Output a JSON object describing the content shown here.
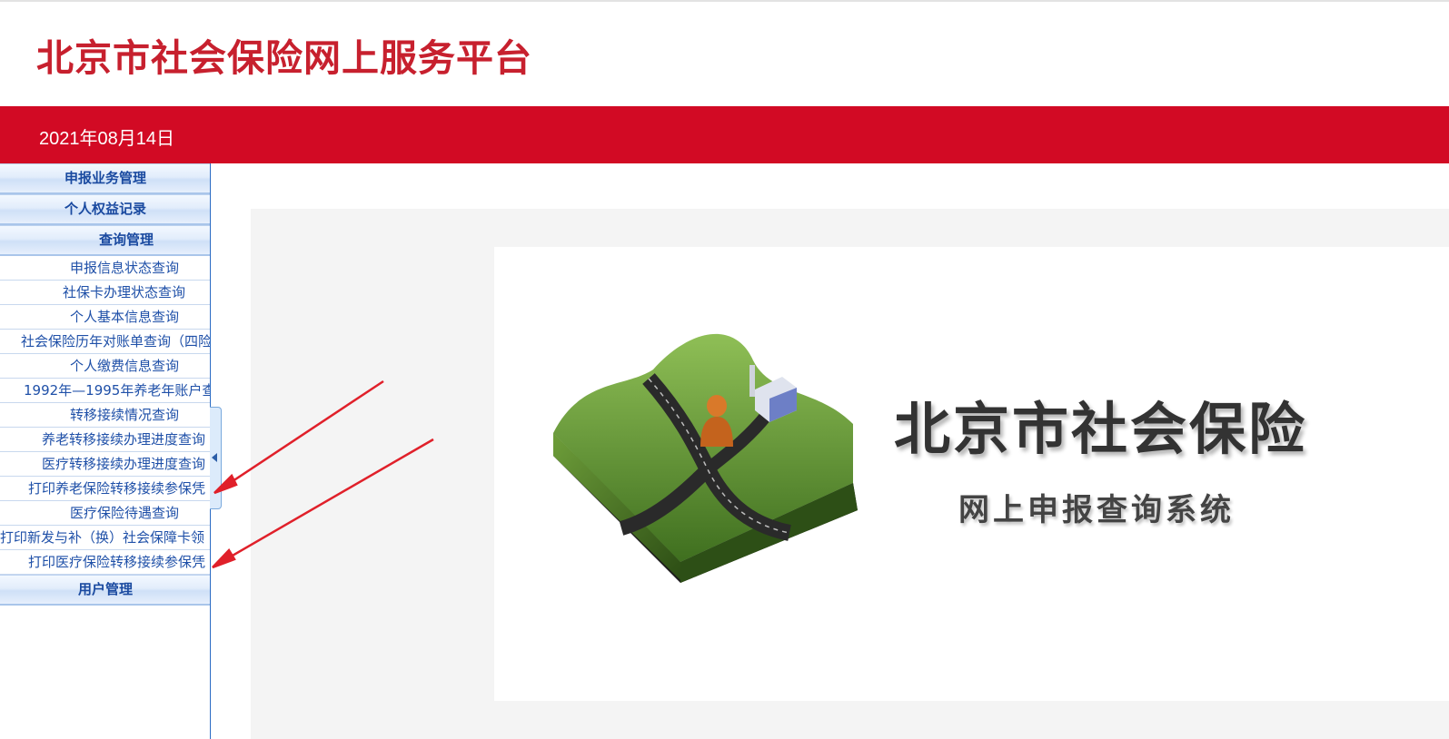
{
  "header": {
    "site_title": "北京市社会保险网上服务平台",
    "date": "2021年08月14日"
  },
  "sidebar": {
    "sections": [
      {
        "label": "申报业务管理"
      },
      {
        "label": "个人权益记录"
      },
      {
        "label": "查询管理"
      }
    ],
    "query_items": [
      {
        "label": "申报信息状态查询"
      },
      {
        "label": "社保卡办理状态查询"
      },
      {
        "label": "个人基本信息查询"
      },
      {
        "label": "社会保险历年对账单查询（四险"
      },
      {
        "label": "个人缴费信息查询"
      },
      {
        "label": "1992年—1995年养老年账户查"
      },
      {
        "label": "转移接续情况查询"
      },
      {
        "label": "养老转移接续办理进度查询"
      },
      {
        "label": "医疗转移接续办理进度查询"
      },
      {
        "label": "打印养老保险转移接续参保凭"
      },
      {
        "label": "医疗保险待遇查询"
      },
      {
        "label": "打印新发与补（换）社会保障卡领"
      },
      {
        "label": "打印医疗保险转移接续参保凭"
      }
    ],
    "user_section": {
      "label": "用户管理"
    }
  },
  "main": {
    "brand_title": "北京市社会保险",
    "brand_subtitle": "网上申报查询系统"
  },
  "colors": {
    "brand_red": "#d20a24",
    "title_red": "#c7202e",
    "menu_blue": "#1f50a8",
    "annotation_red": "#e0202a"
  },
  "icons": [
    "collapse-left-icon",
    "map-landscape-logo",
    "annotation-arrow"
  ]
}
